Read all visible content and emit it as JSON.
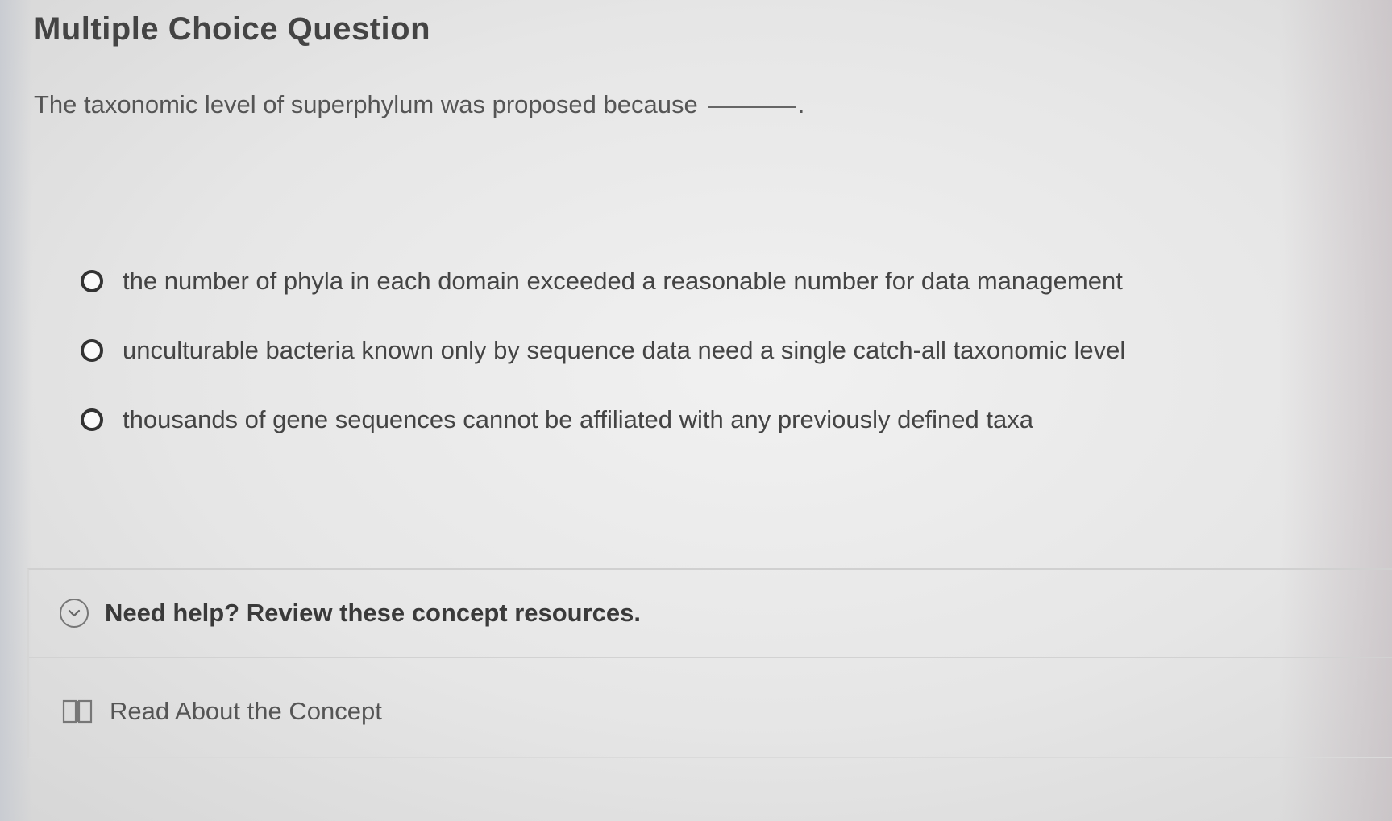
{
  "question": {
    "title": "Multiple Choice Question",
    "prompt": "The taxonomic level of superphylum was proposed because",
    "prompt_end": "."
  },
  "options": [
    {
      "label": "the number of phyla in each domain exceeded a reasonable number for data management",
      "selected": false
    },
    {
      "label": "unculturable bacteria known only by sequence data need a single catch-all taxonomic level",
      "selected": false
    },
    {
      "label": "thousands of gene sequences cannot be affiliated with any previously defined taxa",
      "selected": false
    }
  ],
  "help": {
    "header": "Need help? Review these concept resources.",
    "icon": "chevron-down-circle-icon",
    "resources": [
      {
        "label": "Read About the Concept",
        "icon": "book-icon"
      }
    ]
  }
}
